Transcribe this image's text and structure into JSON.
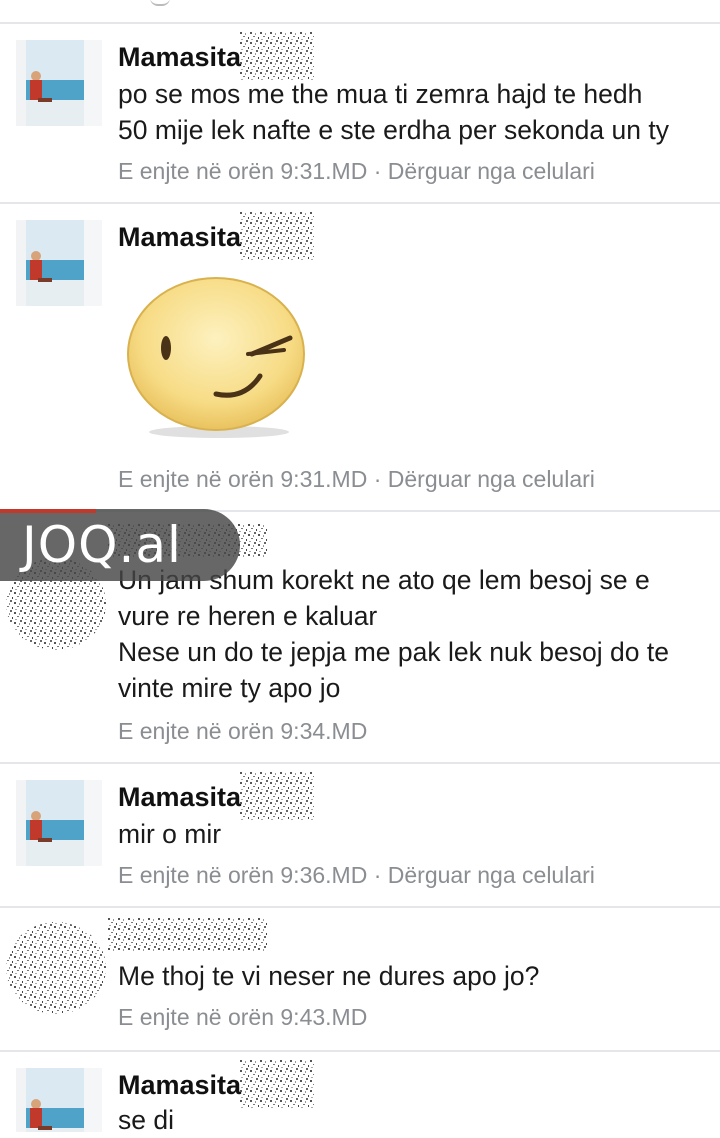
{
  "messages": [
    {
      "sender": "Mamasita",
      "lines": [
        "po se mos me the mua ti zemra hajd te hedh",
        "50 mije lek nafte e ste erdha per sekonda un ty"
      ],
      "time": "E enjte në orën 9:31.MD",
      "via": "Dërguar nga celulari"
    },
    {
      "sender": "Mamasita",
      "sticker": "winking-face-sticker",
      "time": "E enjte në orën 9:31.MD",
      "via": "Dërguar nga celulari"
    },
    {
      "sender": "",
      "lines": [
        "Un jam shum korekt ne ato qe lem besoj se e",
        "vure re heren e kaluar",
        "Nese un do te jepja me pak lek nuk besoj do te",
        "vinte mire ty apo jo"
      ],
      "time": "E enjte në orën 9:34.MD"
    },
    {
      "sender": "Mamasita",
      "lines": [
        "mir o mir"
      ],
      "time": "E enjte në orën 9:36.MD",
      "via": "Dërguar nga celulari"
    },
    {
      "sender": "",
      "lines": [
        "Me thoj te vi neser ne dures apo jo?"
      ],
      "time": "E enjte në orën 9:43.MD"
    },
    {
      "sender": "Mamasita",
      "lines": [
        "se di"
      ]
    }
  ],
  "separator": " · ",
  "watermark": "JOQ.al",
  "colors": {
    "meta": "#8a8d91",
    "divider": "#e4e6ea",
    "watermark_bg": "#464646",
    "sticker_face": "#f7dc86"
  }
}
